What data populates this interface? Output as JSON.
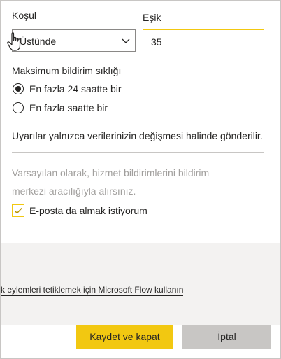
{
  "condition": {
    "label": "Koşul",
    "selected_value": "Üstünde"
  },
  "threshold": {
    "label": "Eşik",
    "value": "35"
  },
  "frequency": {
    "label": "Maksimum bildirim sıklığı",
    "options": [
      {
        "label": "En fazla 24 saatte bir",
        "selected": true
      },
      {
        "label": "En fazla saatte bir",
        "selected": false
      }
    ]
  },
  "info_text": "Uyarılar yalnızca verilerinizin değişmesi halinde gönderilir.",
  "default_note": {
    "line1": "Varsayılan olarak, hizmet bildirimlerini bildirim",
    "line2": "merkezi aracılığıyla alırsınız."
  },
  "email_checkbox": {
    "label": "E-posta da almak istiyorum",
    "checked": true
  },
  "flow_link": "k eylemleri tetiklemek için Microsoft Flow kullanın",
  "buttons": {
    "save": "Kaydet ve kapat",
    "cancel": "İptal"
  },
  "colors": {
    "accent": "#f2c811",
    "secondary_button": "#c8c6c4",
    "band": "#f3f2f1"
  },
  "icons": [
    "chevron-down-icon",
    "hand-cursor-icon",
    "checkmark-icon"
  ]
}
